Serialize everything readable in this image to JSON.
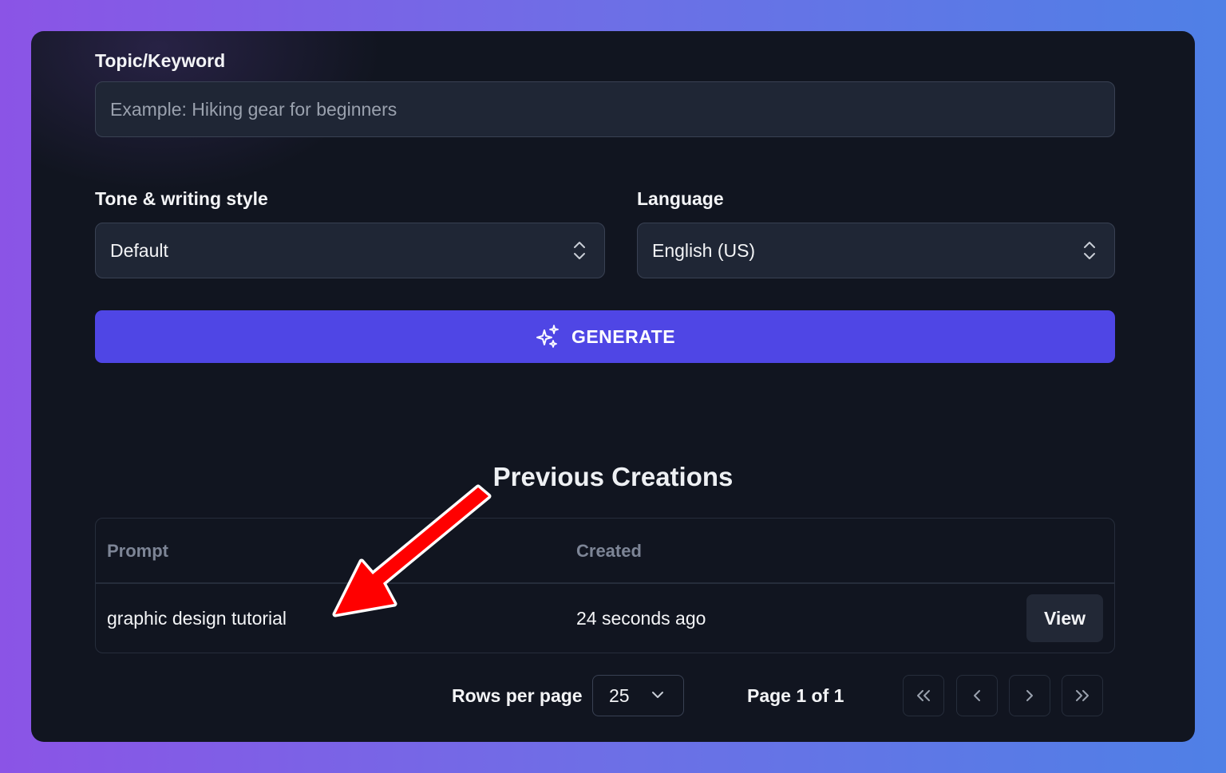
{
  "form": {
    "topic_label": "Topic/Keyword",
    "topic_placeholder": "Example: Hiking gear for beginners",
    "topic_value": "",
    "tone_label": "Tone & writing style",
    "tone_value": "Default",
    "language_label": "Language",
    "language_value": "English (US)",
    "generate_label": "GENERATE"
  },
  "history": {
    "title": "Previous Creations",
    "columns": [
      "Prompt",
      "Created"
    ],
    "rows": [
      {
        "prompt": "graphic design tutorial",
        "created": "24 seconds ago",
        "action": "View"
      }
    ]
  },
  "pagination": {
    "rows_per_page_label": "Rows per page",
    "rows_per_page_value": "25",
    "page_status": "Page 1 of 1"
  },
  "colors": {
    "accent": "#4f46e5",
    "card_bg": "#111520",
    "annotation_arrow": "#ff0000"
  },
  "icons": {
    "generate": "sparkles-icon",
    "selects": "chevron-up-down-icon",
    "rows_select": "chevron-down-icon",
    "first": "chevrons-left-icon",
    "prev": "chevron-left-icon",
    "next": "chevron-right-icon",
    "last": "chevrons-right-icon"
  }
}
